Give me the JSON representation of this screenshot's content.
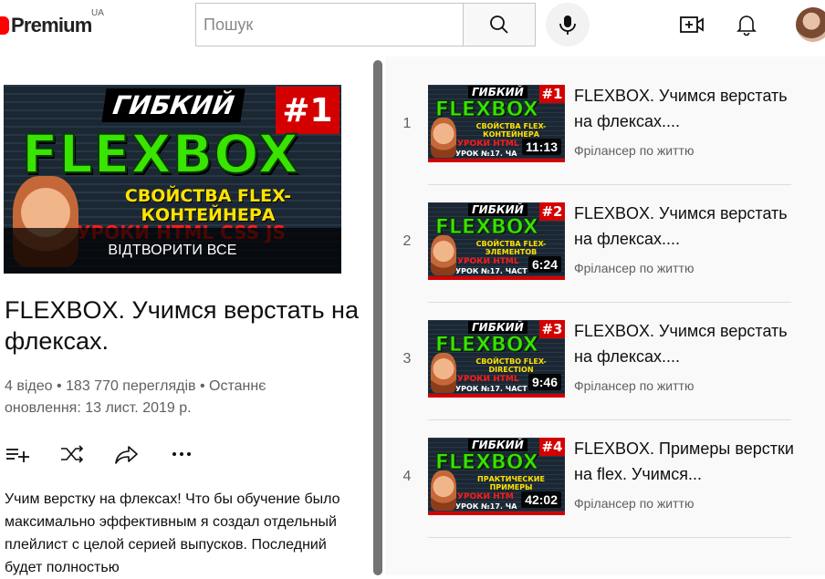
{
  "header": {
    "logo_text": "Premium",
    "country": "UA",
    "search_placeholder": "Пошук"
  },
  "playlist": {
    "thumbnail": {
      "gibkiy": "ГИБКИЙ",
      "number": "#1",
      "flexbox": "FLEXBOX",
      "subtitle": "СВОЙСТВА FLEX-КОНТЕЙНЕРА",
      "lessons": "УРОКИ HTML CSS JS",
      "play_all": "ВІДТВОРИТИ ВСЕ"
    },
    "title": "FLEXBOX. Учимся верстать на флексах.",
    "meta": "4 відео • 183 770 переглядів • Останнє оновлення: 13 лист. 2019 р.",
    "description": "Учим верстку на флексах! Что бы обучение было максимально эффективным я создал отдельный плейлист с целой серией выпусков. Последний будет полностью"
  },
  "videos": [
    {
      "index": "1",
      "title": "FLEXBOX. Учимся верстать на флексах....",
      "channel": "Фрілансер по життю",
      "duration": "11:13",
      "thumb": {
        "gibkiy": "ГИБКИЙ",
        "number": "#1",
        "flexbox": "FLEXBOX",
        "subtitle": "СВОЙСТВА FLEX-КОНТЕЙНЕРА",
        "lessons": "УРОКИ HTML",
        "urok": "УРОК №17. ЧА"
      }
    },
    {
      "index": "2",
      "title": "FLEXBOX. Учимся верстать на флексах....",
      "channel": "Фрілансер по життю",
      "duration": "6:24",
      "thumb": {
        "gibkiy": "ГИБКИЙ",
        "number": "#2",
        "flexbox": "FLEXBOX",
        "subtitle": "СВОЙСТВА FLEX-ЭЛЕМЕНТОВ",
        "lessons": "УРОКИ HTML",
        "urok": "УРОК №17. ЧАСТ"
      }
    },
    {
      "index": "3",
      "title": "FLEXBOX. Учимся верстать на флексах....",
      "channel": "Фрілансер по життю",
      "duration": "9:46",
      "thumb": {
        "gibkiy": "ГИБКИЙ",
        "number": "#3",
        "flexbox": "FLEXBOX",
        "subtitle": "СВОЙСТВО FLEX-DIRECTION",
        "lessons": "УРОКИ HTML",
        "urok": "УРОК №17. ЧАСТ"
      }
    },
    {
      "index": "4",
      "title": "FLEXBOX. Примеры верстки на flex. Учимся...",
      "channel": "Фрілансер по життю",
      "duration": "42:02",
      "thumb": {
        "gibkiy": "ГИБКИЙ",
        "number": "#4",
        "flexbox": "FLEXBOX",
        "subtitle": "ПРАКТИЧЕСКИЕ ПРИМЕРЫ",
        "lessons": "УРОКИ HTM",
        "urok": "УРОК №17. ЧА"
      }
    }
  ],
  "icons": {
    "search": "search-icon",
    "mic": "mic-icon",
    "create": "create-video-icon",
    "notifications": "bell-icon",
    "add_to_queue": "add-to-queue-icon",
    "shuffle": "shuffle-icon",
    "share": "share-icon",
    "more": "more-icon"
  },
  "colors": {
    "brand_red": "#ff0000",
    "text_secondary": "#606060"
  }
}
